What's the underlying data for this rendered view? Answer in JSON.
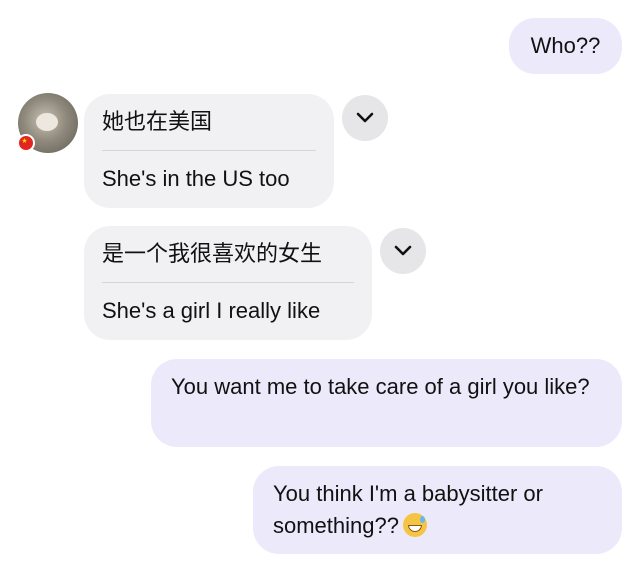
{
  "messages": {
    "m1": {
      "text": "Who??"
    },
    "m2": {
      "original": "她也在美国",
      "translation": "She's in the US too"
    },
    "m3": {
      "original": "是一个我很喜欢的女生",
      "translation": "She's a girl I really like"
    },
    "m4": {
      "text": "You want me to take care of a girl you like?"
    },
    "m5": {
      "text": "You think I'm a babysitter or something??",
      "emoji": "grinning-sweat-emoji"
    }
  },
  "colors": {
    "outgoing_bubble": "#ece9fb",
    "incoming_bubble": "#f1f1f3",
    "chevron_button": "#e6e6e9"
  },
  "icons": {
    "chevron": "chevron-down-icon",
    "flag": "china-flag-icon"
  }
}
